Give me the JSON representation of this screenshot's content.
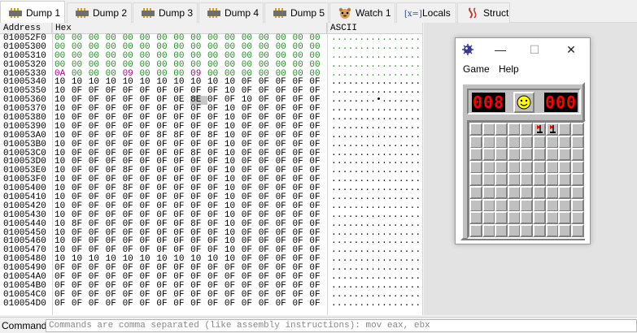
{
  "tabs": [
    {
      "label": "Dump 1",
      "icon": "memory-dump-icon",
      "active": true
    },
    {
      "label": "Dump 2",
      "icon": "memory-dump-icon"
    },
    {
      "label": "Dump 3",
      "icon": "memory-dump-icon"
    },
    {
      "label": "Dump 4",
      "icon": "memory-dump-icon"
    },
    {
      "label": "Dump 5",
      "icon": "memory-dump-icon"
    },
    {
      "label": "Watch 1",
      "icon": "watch-icon"
    },
    {
      "label": "Locals",
      "icon": "locals-icon"
    },
    {
      "label": "Struct",
      "icon": "struct-icon"
    }
  ],
  "dump": {
    "headers": {
      "address": "Address",
      "hex": "Hex",
      "ascii": "ASCII"
    },
    "rows": [
      {
        "addr": "010052F0",
        "hex": "00 00 00 00 00 00 00 00 00 00 00 00 00 00 00 00",
        "ascii": "................",
        "tone": "g"
      },
      {
        "addr": "01005300",
        "hex": "00 00 00 00 00 00 00 00 00 00 00 00 00 00 00 00",
        "ascii": "................",
        "tone": "g"
      },
      {
        "addr": "01005310",
        "hex": "00 00 00 00 00 00 00 00 00 00 00 00 00 00 00 00",
        "ascii": "................",
        "tone": "g"
      },
      {
        "addr": "01005320",
        "hex": "00 00 00 00 00 00 00 00 00 00 00 00 00 00 00 00",
        "ascii": "................",
        "tone": "g"
      },
      {
        "addr": "01005330",
        "hex": "0A 00 00 00 09 00 00 00 09 00 00 00 00 00 00 00",
        "ascii": "................",
        "tone": "g"
      },
      {
        "addr": "01005340",
        "hex": "10 10 10 10 10 10 10 10 10 10 10 0F 0F 0F 0F 0F",
        "ascii": "................"
      },
      {
        "addr": "01005350",
        "hex": "10 0F 0F 0F 0F 0F 0F 0F 0F 0F 10 0F 0F 0F 0F 0F",
        "ascii": "................"
      },
      {
        "addr": "01005360",
        "hex": "10 0F 0F 0F 0F 0F 0F 0E 8E 0F 0F 10 0F 0F 0F 0F",
        "ascii": "........•......."
      },
      {
        "addr": "01005370",
        "hex": "10 0F 0F 0F 0F 0F 0F 0F 0F 0F 10 0F 0F 0F 0F 0F",
        "ascii": "................"
      },
      {
        "addr": "01005380",
        "hex": "10 0F 0F 0F 0F 0F 0F 0F 0F 0F 10 0F 0F 0F 0F 0F",
        "ascii": "................"
      },
      {
        "addr": "01005390",
        "hex": "10 0F 0F 0F 0F 0F 0F 0F 0F 0F 10 0F 0F 0F 0F 0F",
        "ascii": "................"
      },
      {
        "addr": "010053A0",
        "hex": "10 0F 0F 0F 0F 0F 8F 8F 0F 8F 10 0F 0F 0F 0F 0F",
        "ascii": "................"
      },
      {
        "addr": "010053B0",
        "hex": "10 0F 0F 0F 0F 0F 0F 0F 0F 0F 10 0F 0F 0F 0F 0F",
        "ascii": "................"
      },
      {
        "addr": "010053C0",
        "hex": "10 0F 0F 0F 0F 0F 0F 0F 8F 0F 10 0F 0F 0F 0F 0F",
        "ascii": "................"
      },
      {
        "addr": "010053D0",
        "hex": "10 0F 0F 0F 0F 0F 0F 0F 0F 0F 10 0F 0F 0F 0F 0F",
        "ascii": "................"
      },
      {
        "addr": "010053E0",
        "hex": "10 0F 0F 0F 8F 0F 0F 0F 0F 0F 10 0F 0F 0F 0F 0F",
        "ascii": "................"
      },
      {
        "addr": "010053F0",
        "hex": "10 0F 0F 0F 0F 0F 0F 0F 0F 0F 10 0F 0F 0F 0F 0F",
        "ascii": "................"
      },
      {
        "addr": "01005400",
        "hex": "10 0F 0F 0F 8F 0F 0F 0F 0F 0F 10 0F 0F 0F 0F 0F",
        "ascii": "................"
      },
      {
        "addr": "01005410",
        "hex": "10 0F 0F 0F 0F 0F 0F 0F 0F 0F 10 0F 0F 0F 0F 0F",
        "ascii": "................"
      },
      {
        "addr": "01005420",
        "hex": "10 0F 0F 0F 0F 0F 0F 0F 0F 0F 10 0F 0F 0F 0F 0F",
        "ascii": "................"
      },
      {
        "addr": "01005430",
        "hex": "10 0F 0F 0F 0F 0F 0F 0F 0F 0F 10 0F 0F 0F 0F 0F",
        "ascii": "................"
      },
      {
        "addr": "01005440",
        "hex": "10 8F 0F 0F 0F 0F 0F 0F 8F 0F 10 0F 0F 0F 0F 0F",
        "ascii": "................"
      },
      {
        "addr": "01005450",
        "hex": "10 0F 0F 0F 0F 0F 0F 0F 0F 0F 10 0F 0F 0F 0F 0F",
        "ascii": "................"
      },
      {
        "addr": "01005460",
        "hex": "10 0F 0F 0F 0F 0F 0F 0F 0F 0F 10 0F 0F 0F 0F 0F",
        "ascii": "................"
      },
      {
        "addr": "01005470",
        "hex": "10 0F 0F 0F 0F 0F 0F 0F 0F 0F 10 0F 0F 0F 0F 0F",
        "ascii": "................"
      },
      {
        "addr": "01005480",
        "hex": "10 10 10 10 10 10 10 10 10 10 10 0F 0F 0F 0F 0F",
        "ascii": "................"
      },
      {
        "addr": "01005490",
        "hex": "0F 0F 0F 0F 0F 0F 0F 0F 0F 0F 0F 0F 0F 0F 0F 0F",
        "ascii": "................"
      },
      {
        "addr": "010054A0",
        "hex": "0F 0F 0F 0F 0F 0F 0F 0F 0F 0F 0F 0F 0F 0F 0F 0F",
        "ascii": "................"
      },
      {
        "addr": "010054B0",
        "hex": "0F 0F 0F 0F 0F 0F 0F 0F 0F 0F 0F 0F 0F 0F 0F 0F",
        "ascii": "................"
      },
      {
        "addr": "010054C0",
        "hex": "0F 0F 0F 0F 0F 0F 0F 0F 0F 0F 0F 0F 0F 0F 0F 0F",
        "ascii": "................"
      },
      {
        "addr": "010054D0",
        "hex": "0F 0F 0F 0F 0F 0F 0F 0F 0F 0F 0F 0F 0F 0F 0F 0F",
        "ascii": "................"
      }
    ],
    "selected": {
      "row": 7,
      "col": 8
    },
    "colors": {
      "zero": "#2a8a2a",
      "magenta": "#b0008a",
      "selection": "#c8c8c8"
    }
  },
  "minesweeper": {
    "app_icon": "mine-icon",
    "window_controls": {
      "minimize": "—",
      "maximize": "☐",
      "close": "✕"
    },
    "menu": [
      "Game",
      "Help"
    ],
    "mine_counter": "008",
    "timer": "000",
    "smiley": "smiley-face-icon",
    "grid": {
      "cols": 9,
      "rows": 9,
      "flags": [
        [
          0,
          5
        ],
        [
          0,
          6
        ]
      ]
    },
    "flag_icon": "flag-icon"
  },
  "command": {
    "label": "Command:",
    "placeholder": "Commands are comma separated (like assembly instructions): mov eax, ebx"
  }
}
